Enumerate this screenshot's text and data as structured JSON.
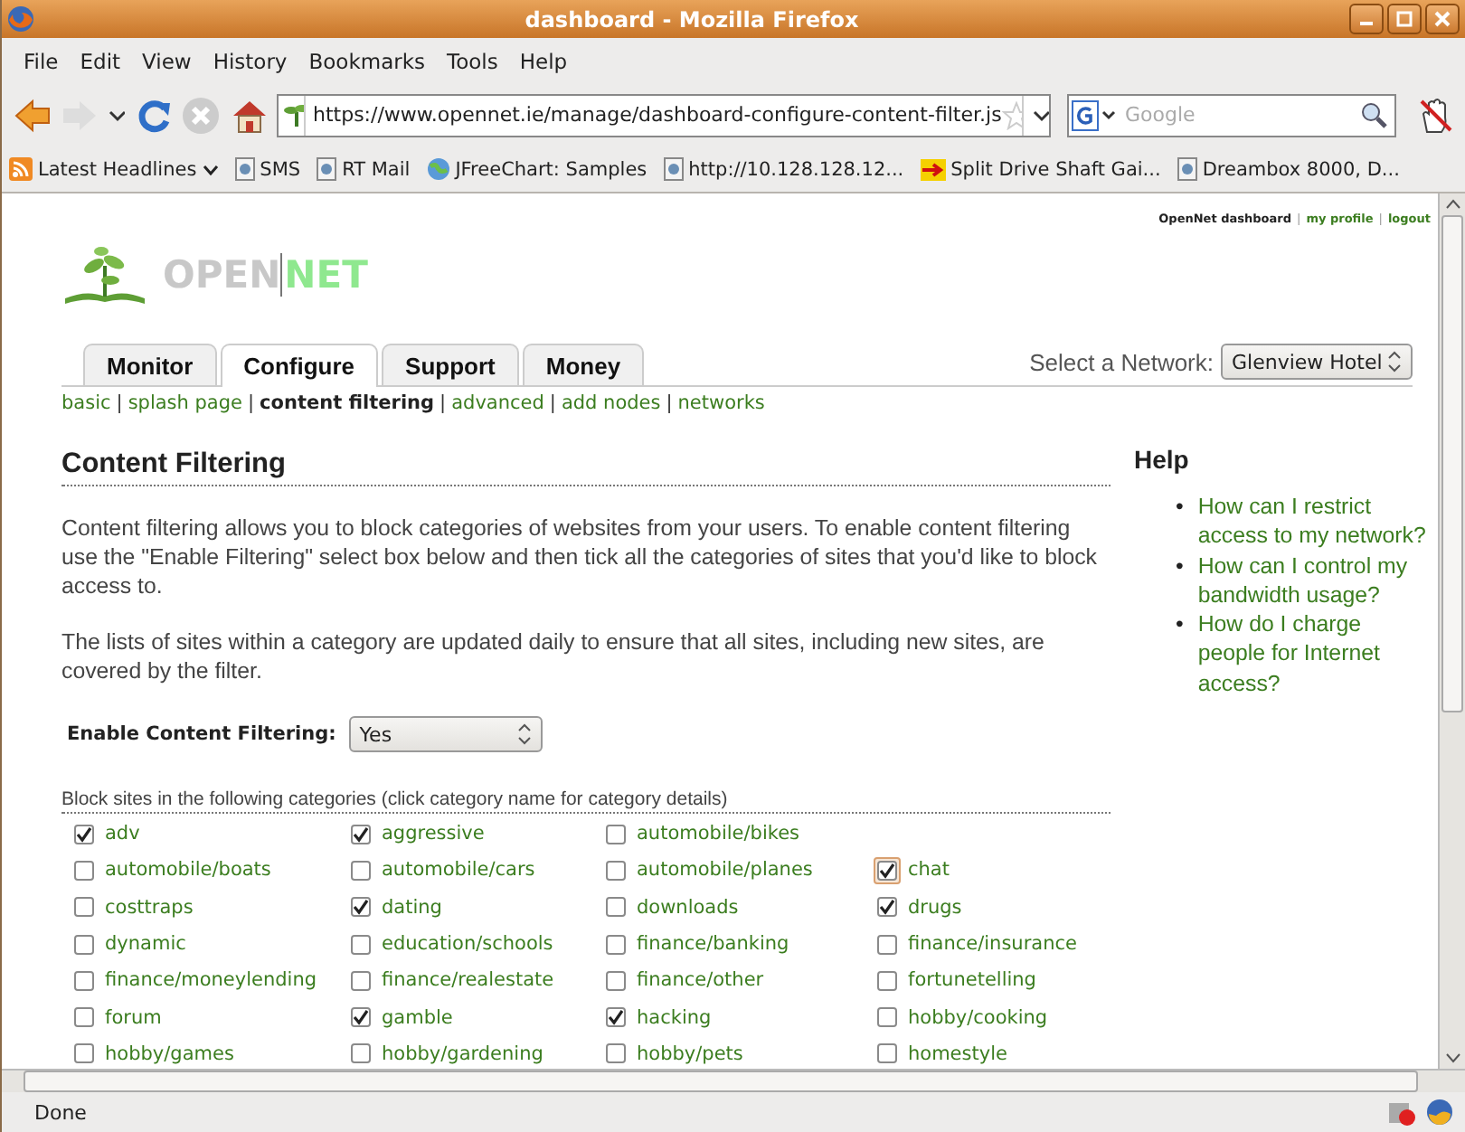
{
  "window": {
    "title": "dashboard - Mozilla Firefox"
  },
  "menu": [
    "File",
    "Edit",
    "View",
    "History",
    "Bookmarks",
    "Tools",
    "Help"
  ],
  "toolbar": {
    "url": "https://www.opennet.ie/manage/dashboard-configure-content-filter.js",
    "search": {
      "placeholder": "Google"
    }
  },
  "bookmarks": [
    {
      "label": "Latest Headlines",
      "kind": "feed"
    },
    {
      "label": "SMS",
      "kind": "page"
    },
    {
      "label": "RT Mail",
      "kind": "page"
    },
    {
      "label": "JFreeChart: Samples",
      "kind": "chart"
    },
    {
      "label": "http://10.128.128.12...",
      "kind": "page"
    },
    {
      "label": "Split Drive Shaft Gai...",
      "kind": "arrow"
    },
    {
      "label": "Dreambox 8000, D...",
      "kind": "page"
    }
  ],
  "page": {
    "top_links": {
      "title": "OpenNet dashboard",
      "links": [
        "my profile",
        "logout"
      ]
    },
    "separator": "|",
    "logo": {
      "first": "OPEN",
      "second": "NET"
    },
    "tabs": [
      {
        "label": "Monitor",
        "selected": false
      },
      {
        "label": "Configure",
        "selected": true
      },
      {
        "label": "Support",
        "selected": false
      },
      {
        "label": "Money",
        "selected": false
      }
    ],
    "network": {
      "label": "Select a Network:",
      "value": "Glenview Hotel"
    },
    "subnav": [
      {
        "label": "basic",
        "selected": false
      },
      {
        "label": "splash page",
        "selected": false
      },
      {
        "label": "content filtering",
        "selected": true
      },
      {
        "label": "advanced",
        "selected": false
      },
      {
        "label": "add nodes",
        "selected": false
      },
      {
        "label": "networks",
        "selected": false
      }
    ],
    "heading": "Content Filtering",
    "paragraphs": [
      "Content filtering allows you to block categories of websites from your users. To enable content filtering use the \"Enable Filtering\" select box below and then tick all the categories of sites that you'd like to block access to.",
      "The lists of sites within a category are updated daily to ensure that all sites, including new sites, are covered by the filter."
    ],
    "filter": {
      "label": "Enable Content Filtering:",
      "value": "Yes"
    },
    "categories": {
      "caption": "Block sites in the following categories (click category name for category details)",
      "rows": [
        [
          {
            "label": "adv",
            "checked": true,
            "focused": false
          },
          {
            "label": "aggressive",
            "checked": true,
            "focused": false
          },
          {
            "label": "automobile/bikes",
            "checked": false,
            "focused": false
          }
        ],
        [
          {
            "label": "automobile/boats",
            "checked": false,
            "focused": false
          },
          {
            "label": "automobile/cars",
            "checked": false,
            "focused": false
          },
          {
            "label": "automobile/planes",
            "checked": false,
            "focused": false
          },
          {
            "label": "chat",
            "checked": true,
            "focused": true
          }
        ],
        [
          {
            "label": "costtraps",
            "checked": false,
            "focused": false
          },
          {
            "label": "dating",
            "checked": true,
            "focused": false
          },
          {
            "label": "downloads",
            "checked": false,
            "focused": false
          },
          {
            "label": "drugs",
            "checked": true,
            "focused": false
          }
        ],
        [
          {
            "label": "dynamic",
            "checked": false,
            "focused": false
          },
          {
            "label": "education/schools",
            "checked": false,
            "focused": false
          },
          {
            "label": "finance/banking",
            "checked": false,
            "focused": false
          },
          {
            "label": "finance/insurance",
            "checked": false,
            "focused": false
          }
        ],
        [
          {
            "label": "finance/moneylending",
            "checked": false,
            "focused": false
          },
          {
            "label": "finance/realestate",
            "checked": false,
            "focused": false
          },
          {
            "label": "finance/other",
            "checked": false,
            "focused": false
          },
          {
            "label": "fortunetelling",
            "checked": false,
            "focused": false
          }
        ],
        [
          {
            "label": "forum",
            "checked": false,
            "focused": false
          },
          {
            "label": "gamble",
            "checked": true,
            "focused": false
          },
          {
            "label": "hacking",
            "checked": true,
            "focused": false
          },
          {
            "label": "hobby/cooking",
            "checked": false,
            "focused": false
          }
        ],
        [
          {
            "label": "hobby/games",
            "checked": false,
            "focused": false
          },
          {
            "label": "hobby/gardening",
            "checked": false,
            "focused": false
          },
          {
            "label": "hobby/pets",
            "checked": false,
            "focused": false
          },
          {
            "label": "homestyle",
            "checked": false,
            "focused": false
          }
        ]
      ]
    },
    "help": {
      "title": "Help",
      "bullet": "•",
      "items": [
        "How can I restrict access to my network?",
        "How can I control my bandwidth usage?",
        "How do I charge people for Internet access?"
      ]
    }
  },
  "status_bar": {
    "text": "Done"
  }
}
